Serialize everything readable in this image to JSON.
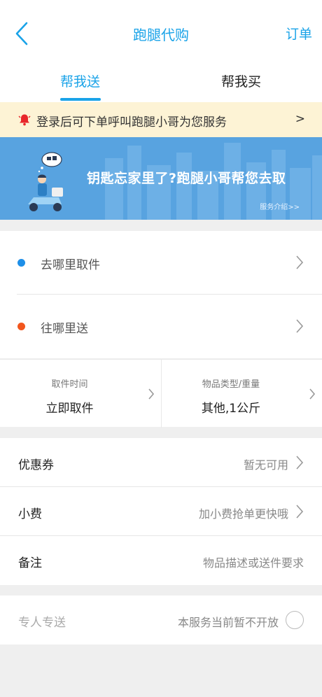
{
  "header": {
    "title": "跑腿代购",
    "orders_label": "订单"
  },
  "tabs": [
    {
      "label": "帮我送",
      "active": true
    },
    {
      "label": "帮我买",
      "active": false
    }
  ],
  "notice": {
    "text": "登录后可下单呼叫跑腿小哥为您服务",
    "arrow": ">"
  },
  "banner": {
    "headline": "钥匙忘家里了?跑腿小哥帮您去取",
    "link": "服务介绍>>"
  },
  "address": {
    "pickup_label": "去哪里取件",
    "delivery_label": "往哪里送"
  },
  "details": {
    "pickup_time_caption": "取件时间",
    "pickup_time_value": "立即取件",
    "item_caption": "物品类型/重量",
    "item_value": "其他,1公斤"
  },
  "options": {
    "coupon_label": "优惠券",
    "coupon_value": "暂无可用",
    "tip_label": "小费",
    "tip_value": "加小费抢单更快哦",
    "remark_label": "备注",
    "remark_value": "物品描述或送件要求"
  },
  "special": {
    "label": "专人专送",
    "status": "本服务当前暂不开放"
  },
  "colors": {
    "accent": "#1aa3e8",
    "pickup_dot": "#1e8fe8",
    "delivery_dot": "#f2561d",
    "notice_bg": "#fdf3d5",
    "banner_bg": "#58a3e0"
  }
}
